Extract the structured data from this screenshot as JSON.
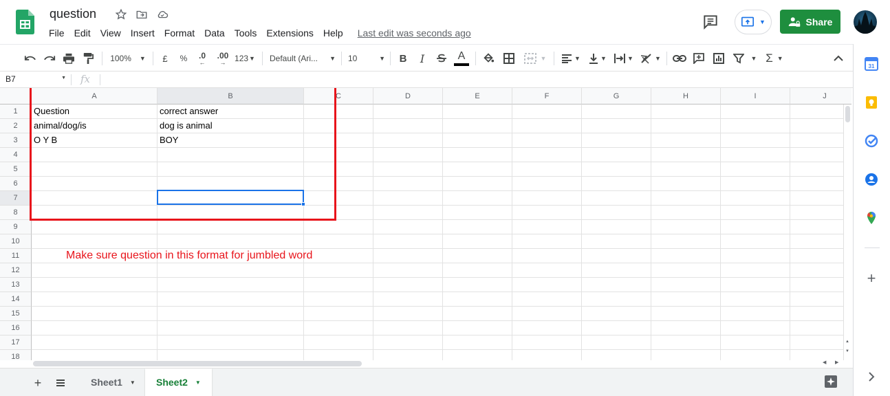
{
  "document": {
    "title": "question",
    "last_edit": "Last edit was seconds ago"
  },
  "menu": [
    "File",
    "Edit",
    "View",
    "Insert",
    "Format",
    "Data",
    "Tools",
    "Extensions",
    "Help"
  ],
  "header": {
    "share_label": "Share"
  },
  "toolbar": {
    "zoom": "100%",
    "currency": "£",
    "percent": "%",
    "decrease_decimal": ".0",
    "increase_decimal": ".00",
    "more_formats": "123",
    "font": "Default (Ari...",
    "font_size": "10",
    "bold": "B",
    "italic": "I",
    "text_color_glyph": "A"
  },
  "formula_bar": {
    "name_box": "B7",
    "fx": "fx"
  },
  "grid": {
    "columns": [
      "A",
      "B",
      "C",
      "D",
      "E",
      "F",
      "G",
      "H",
      "I",
      "J"
    ],
    "rows": [
      "1",
      "2",
      "3",
      "4",
      "5",
      "6",
      "7",
      "8",
      "9",
      "10",
      "11",
      "12",
      "13",
      "14",
      "15",
      "16",
      "17",
      "18"
    ],
    "active_column": "B",
    "active_row": "7",
    "cells": {
      "A1": "Question",
      "B1": "correct answer",
      "A2": "animal/dog/is",
      "B2": "dog is animal",
      "A3": "O Y B",
      "B3": "BOY"
    },
    "annotation": "Make sure question in this format for jumbled word"
  },
  "sheets": [
    {
      "name": "Sheet1",
      "active": false
    },
    {
      "name": "Sheet2",
      "active": true
    }
  ],
  "colors": {
    "share_green": "#1e8e3e",
    "selection_blue": "#1a73e8",
    "annotation_red": "#e8141b",
    "active_tab_green": "#188038"
  },
  "side_panel_icons": [
    "calendar-icon",
    "keep-icon",
    "tasks-icon",
    "contacts-icon",
    "maps-icon",
    "add-icon",
    "expand-icon"
  ]
}
